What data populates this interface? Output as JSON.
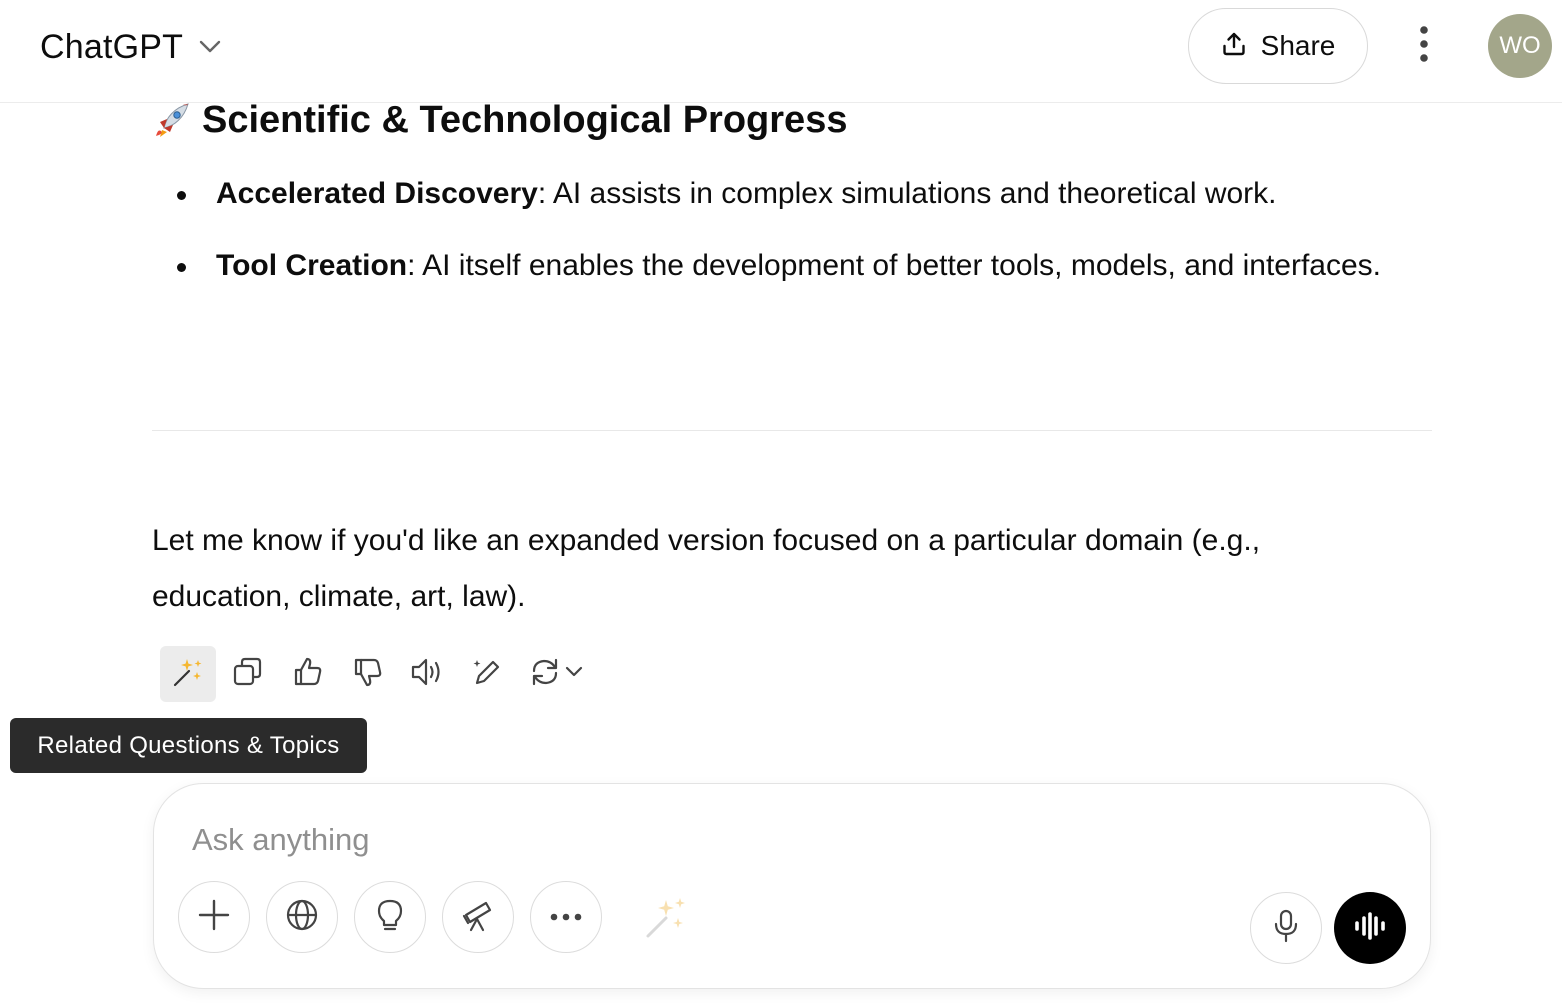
{
  "header": {
    "model_name": "ChatGPT",
    "share_label": "Share",
    "avatar_initials": "WO",
    "avatar_color": "#a3a68a"
  },
  "content": {
    "section_icon": "rocket-icon",
    "section_heading": "Scientific & Technological Progress",
    "bullets": [
      {
        "bold": "Accelerated Discovery",
        "text": ": AI assists in complex simulations and theoretical work."
      },
      {
        "bold": "Tool Creation",
        "text": ": AI itself enables the development of better tools, models, and interfaces."
      }
    ],
    "closing": "Let me know if you'd like an expanded version focused on a particular domain (e.g., education, climate, art, law)."
  },
  "actions": {
    "items": [
      "related-questions-icon",
      "copy-icon",
      "thumbs-up-icon",
      "thumbs-down-icon",
      "read-aloud-icon",
      "edit-icon",
      "regenerate-icon"
    ],
    "tooltip": "Related Questions & Topics"
  },
  "composer": {
    "placeholder": "Ask anything",
    "tools": [
      "plus-icon",
      "globe-icon",
      "lightbulb-icon",
      "telescope-icon",
      "more-dots-icon",
      "sparkle-icon"
    ]
  }
}
